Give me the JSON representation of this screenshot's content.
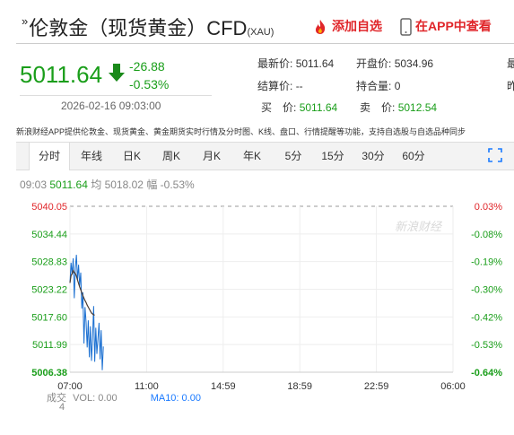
{
  "header": {
    "prefix": "»",
    "title": "伦敦金（现货黄金）CFD",
    "code": "(XAU)",
    "fav_label": "添加自选",
    "app_label": "在APP中查看"
  },
  "quote": {
    "price": "5011.64",
    "change": "-26.88",
    "change_pct": "-0.53%",
    "datetime": "2026-02-16 09:03:00"
  },
  "stats": {
    "latest_label": "最新价:",
    "latest_value": "5011.64",
    "open_label": "开盘价:",
    "open_value": "5034.96",
    "settle_label": "结算价:",
    "settle_value": "--",
    "hold_label": "持合量:",
    "hold_value": "0",
    "buy_label": "买　价:",
    "buy_value": "5011.64",
    "sell_label": "卖　价:",
    "sell_value": "5012.54",
    "cut1": "最",
    "cut2": "昨"
  },
  "notice": "新浪财经APP提供伦敦金、现货黄金、黄金期货实时行情及分时图、K线、盘口、行情提醒等功能，支持自选股与自选品种同步",
  "tabs": [
    {
      "label": "分时"
    },
    {
      "label": "年线"
    },
    {
      "label": "日K"
    },
    {
      "label": "周K"
    },
    {
      "label": "月K"
    },
    {
      "label": "年K"
    },
    {
      "label": "5分"
    },
    {
      "label": "15分"
    },
    {
      "label": "30分"
    },
    {
      "label": "60分"
    }
  ],
  "info_bar": {
    "time": "09:03",
    "price": "5011.64",
    "avg_label": "均",
    "avg": "5018.02",
    "amp_label": "幅",
    "amp": "-0.53%"
  },
  "watermark": "新浪财经",
  "chart_data": {
    "type": "line",
    "y_ticks": [
      "5040.05",
      "5034.44",
      "5028.83",
      "5023.22",
      "5017.60",
      "5011.99",
      "5006.38"
    ],
    "pct_ticks": [
      "0.03%",
      "-0.08%",
      "-0.19%",
      "-0.30%",
      "-0.42%",
      "-0.53%",
      "-0.64%"
    ],
    "x_ticks": [
      "07:00",
      "11:00",
      "14:59",
      "18:59",
      "22:59",
      "06:00"
    ],
    "ylim": [
      5006.38,
      5040.05
    ],
    "prev_close": 5038.52,
    "series": [
      {
        "values": [
          5024.5,
          5028.6,
          5026.2,
          5029.5,
          5021.4,
          5027.6,
          5030.2,
          5025.1,
          5028.2,
          5023.9,
          5026.6,
          5019.3,
          5022.6,
          5012.2,
          5019.6,
          5016.5,
          5011.4,
          5016.9,
          5009.4,
          5015.7,
          5008.7,
          5013.3,
          5019.8,
          5008.5,
          5015.4,
          5010.1,
          5013.2,
          5016.4,
          5009.0,
          5014.9,
          5006.8,
          5011.6
        ]
      },
      {
        "values": [
          5024.5,
          5026.0,
          5026.4,
          5027.0,
          5026.6,
          5026.4,
          5025.9,
          5025.1,
          5024.4,
          5023.7,
          5023.1,
          5022.5,
          5021.9,
          5021.4,
          5020.9,
          5020.5,
          5020.0,
          5019.6,
          5019.2,
          5018.8,
          5018.4,
          5018.2,
          5018.0,
          5018.0
        ]
      }
    ]
  },
  "volume": {
    "cj_label": "成交",
    "cj_value": "4",
    "vol_label": "VOL:",
    "vol_value": "0.00",
    "ma_label": "MA10:",
    "ma_value": "0.00"
  }
}
